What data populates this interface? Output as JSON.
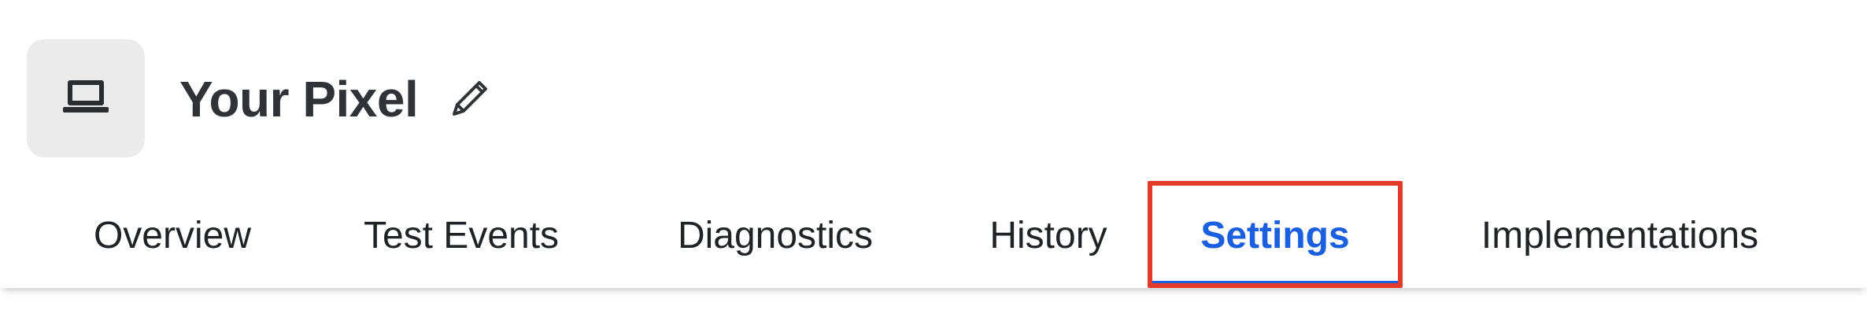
{
  "header": {
    "title": "Your Pixel",
    "pixel_icon": "laptop-icon",
    "edit_icon": "pencil-icon"
  },
  "tabs": [
    {
      "label": "Overview"
    },
    {
      "label": "Test Events"
    },
    {
      "label": "Diagnostics"
    },
    {
      "label": "History"
    },
    {
      "label": "Settings",
      "active": true
    },
    {
      "label": "Implementations"
    }
  ],
  "colors": {
    "active_tab": "#1a5fe0",
    "highlight_border": "#e23b2c",
    "title_text": "#2f3337",
    "icon_box_bg": "#ebebeb"
  }
}
